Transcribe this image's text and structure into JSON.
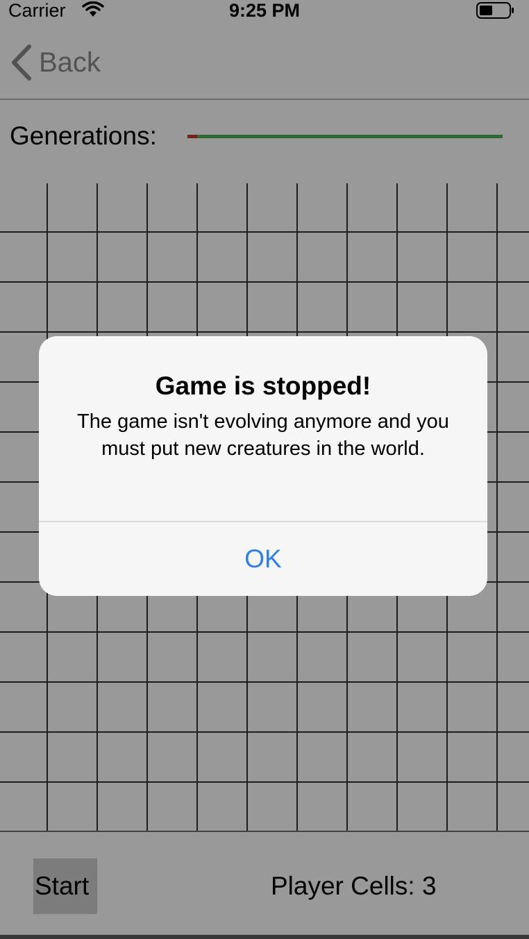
{
  "status_bar": {
    "carrier": "Carrier",
    "time": "9:25 PM",
    "wifi_icon": "wifi-icon",
    "battery_icon": "battery-icon",
    "battery_level": 0.45
  },
  "nav": {
    "back_label": "Back",
    "back_icon": "chevron-left-icon"
  },
  "generations": {
    "label": "Generations:",
    "progress": 0.03,
    "fill_color": "#c0392b",
    "track_color": "#4caf50"
  },
  "grid": {
    "columns": 11,
    "rows": 13,
    "line_color": "#333333"
  },
  "bottom": {
    "start_label": "Start",
    "player_cells": "Player Cells: 3"
  },
  "alert": {
    "title": "Game is stopped!",
    "message": "The game isn't evolving anymore and you must put new creatures in the world.",
    "ok_label": "OK",
    "accent": "#2f7fe6"
  }
}
